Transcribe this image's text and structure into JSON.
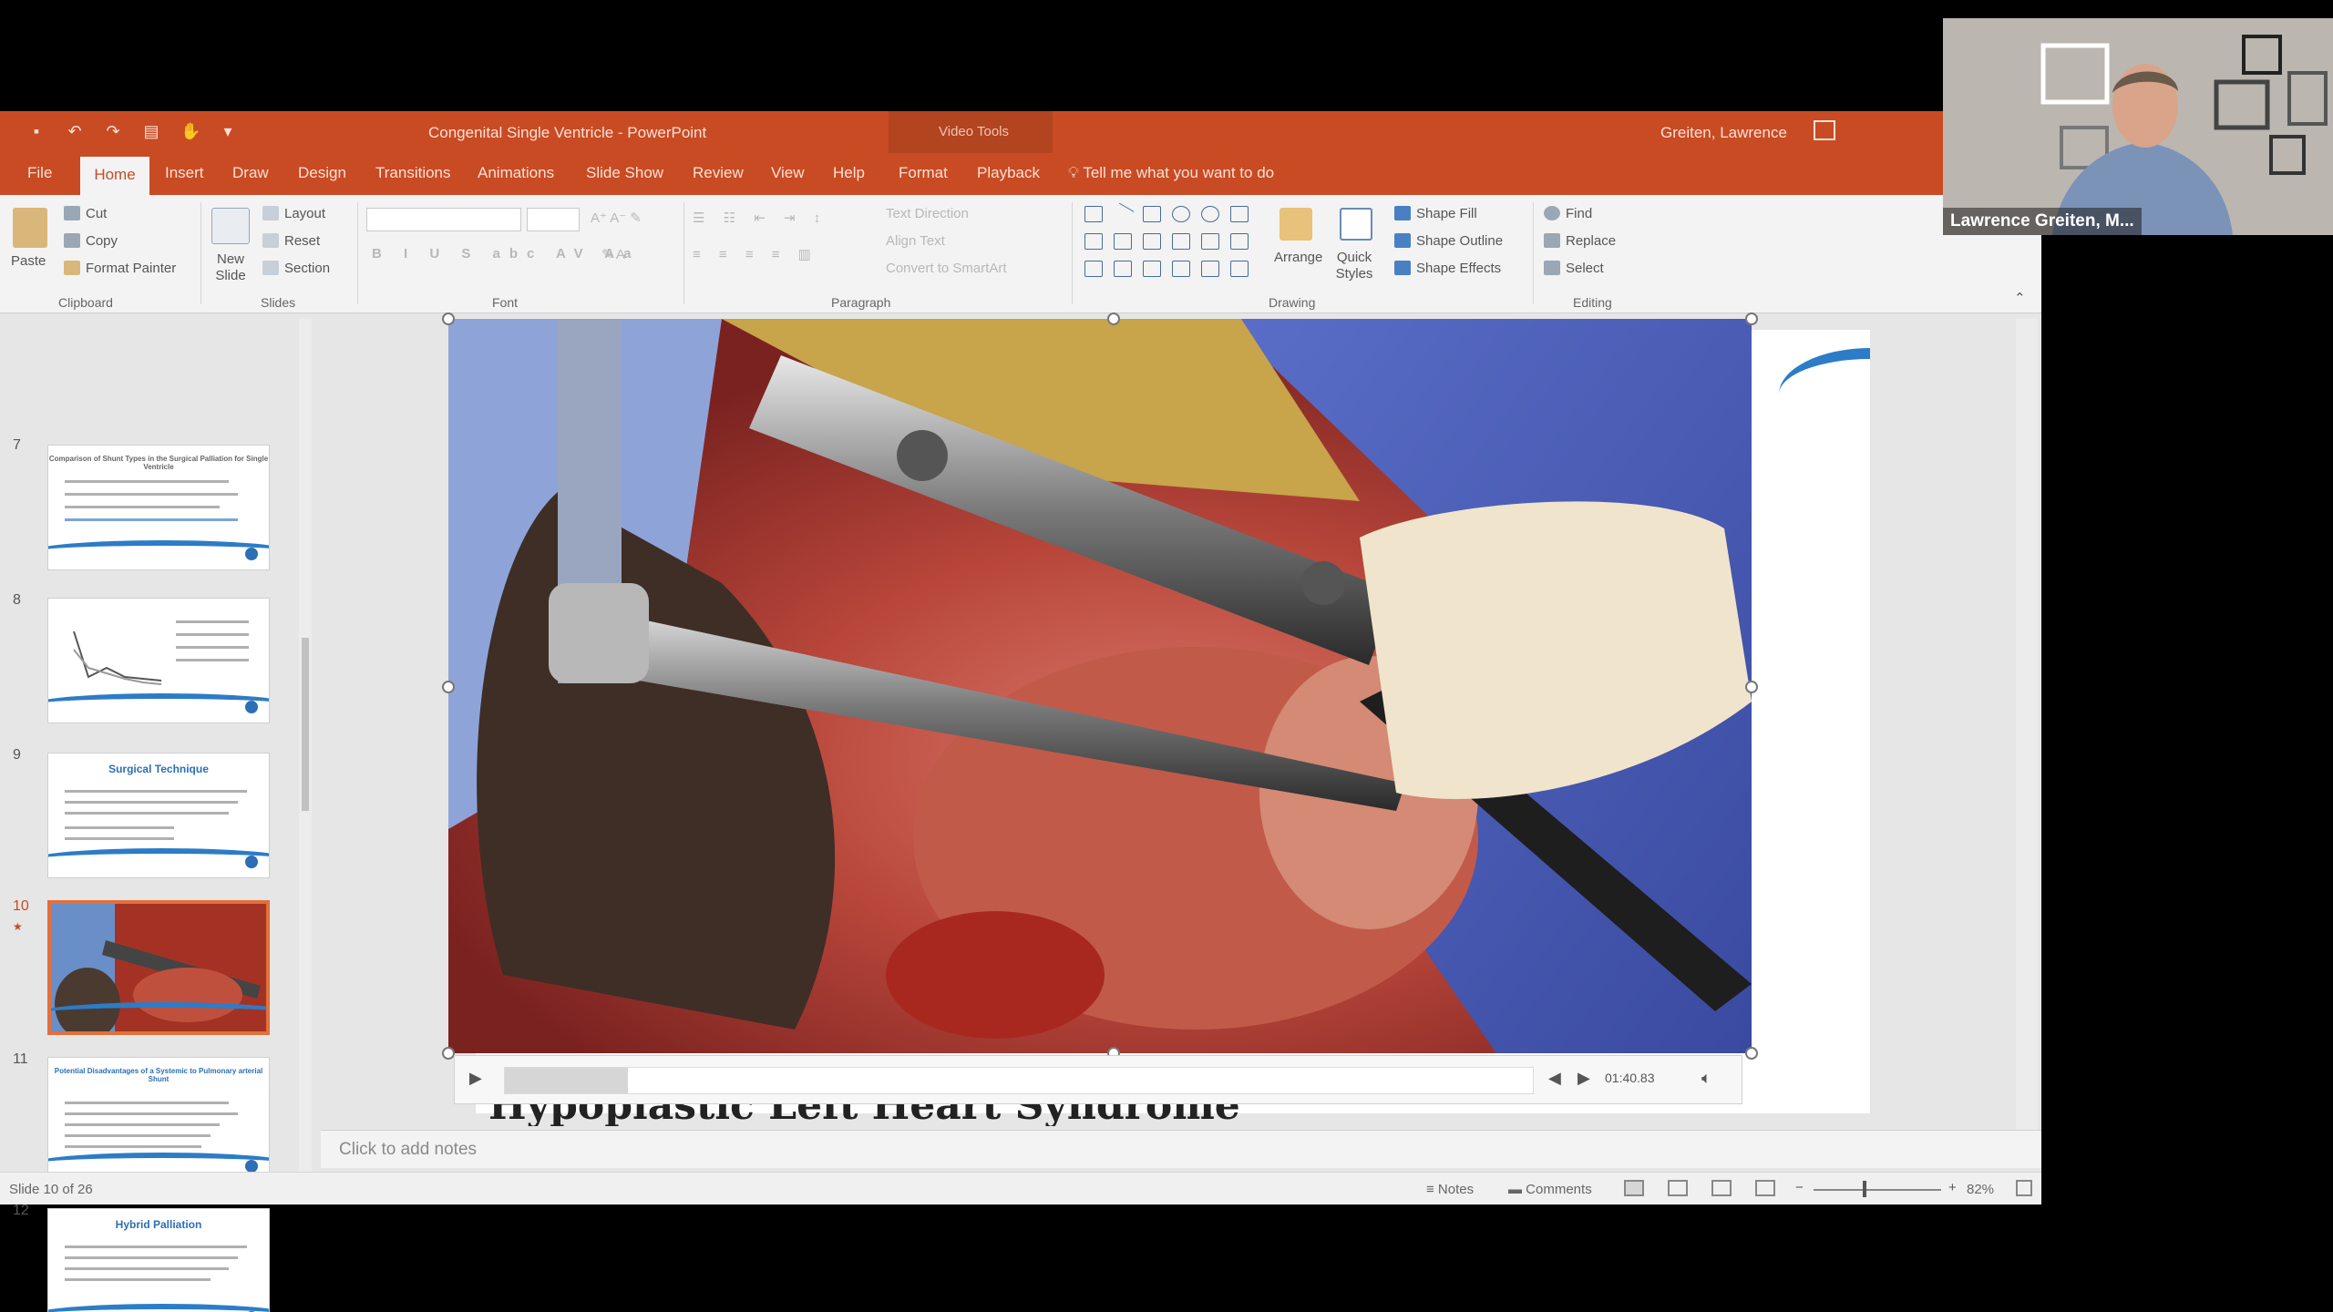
{
  "titlebar": {
    "document_title": "Congenital Single Ventricle  -  PowerPoint",
    "context_tools": "Video Tools",
    "user": "Greiten, Lawrence"
  },
  "tabs": [
    "File",
    "Home",
    "Insert",
    "Draw",
    "Design",
    "Transitions",
    "Animations",
    "Slide Show",
    "Review",
    "View",
    "Help",
    "Format",
    "Playback"
  ],
  "tell_me": "Tell me what you want to do",
  "ribbon": {
    "clipboard": {
      "paste": "Paste",
      "cut": "Cut",
      "copy": "Copy",
      "format_painter": "Format Painter",
      "label": "Clipboard"
    },
    "slides": {
      "new_slide": "New Slide",
      "layout": "Layout",
      "reset": "Reset",
      "section": "Section",
      "label": "Slides"
    },
    "font": {
      "label": "Font"
    },
    "paragraph": {
      "text_direction": "Text Direction",
      "align_text": "Align Text",
      "smartart": "Convert to SmartArt",
      "label": "Paragraph"
    },
    "drawing": {
      "arrange": "Arrange",
      "quick_styles": "Quick Styles",
      "shape_fill": "Shape Fill",
      "shape_outline": "Shape Outline",
      "shape_effects": "Shape Effects",
      "label": "Drawing"
    },
    "editing": {
      "find": "Find",
      "replace": "Replace",
      "select": "Select",
      "label": "Editing"
    }
  },
  "thumbnails": [
    {
      "num": "7",
      "title": "Comparison of Shunt Types in the Surgical Palliation for Single Ventricle"
    },
    {
      "num": "8",
      "title": ""
    },
    {
      "num": "9",
      "title": "Surgical Technique"
    },
    {
      "num": "10",
      "title": ""
    },
    {
      "num": "11",
      "title": "Potential Disadvantages of a Systemic to Pulmonary arterial Shunt"
    },
    {
      "num": "12",
      "title": "Hybrid Palliation"
    }
  ],
  "slide": {
    "heading": "Hypoplastic Left Heart Syndrome"
  },
  "video": {
    "time": "01:40.83",
    "progress": 0.12
  },
  "notes_placeholder": "Click to add notes",
  "status": {
    "slide_counter": "Slide 10 of 26",
    "notes": "Notes",
    "comments": "Comments",
    "zoom": "82%"
  },
  "webcam": {
    "participant": "Lawrence Greiten, M..."
  },
  "colors": {
    "brand": "#c84b24",
    "accent_blue": "#2c7cc7",
    "selected_thumb": "#e2703a"
  }
}
